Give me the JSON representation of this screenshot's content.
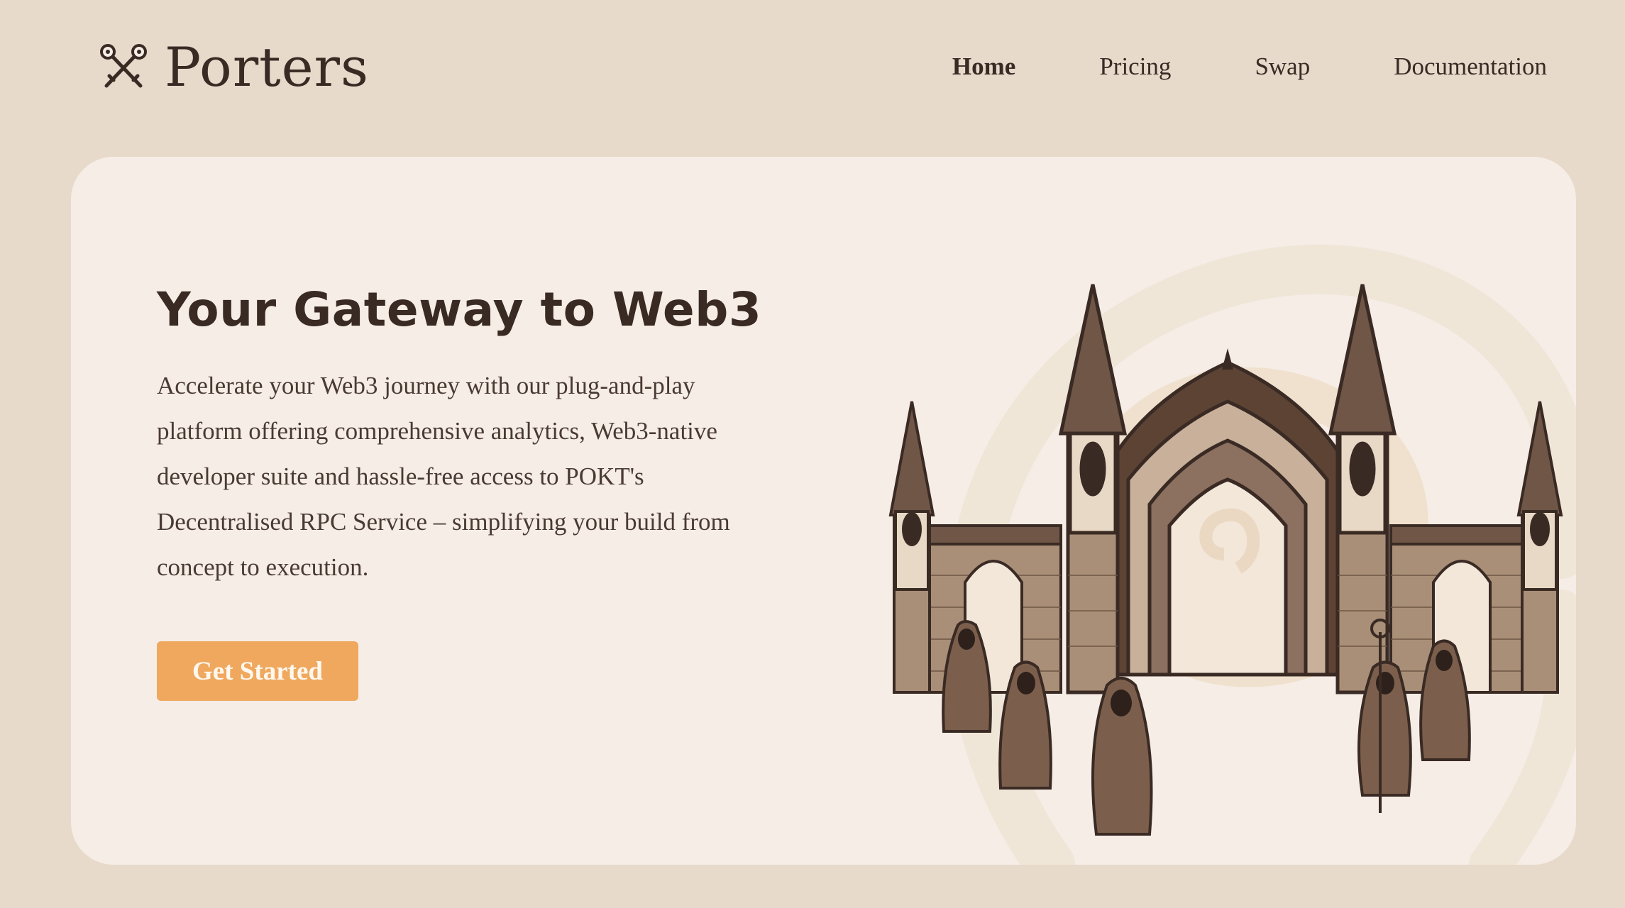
{
  "brand": {
    "name": "Porters",
    "logo_icon": "crossed-keys-icon"
  },
  "nav": {
    "items": [
      {
        "label": "Home",
        "active": true
      },
      {
        "label": "Pricing",
        "active": false
      },
      {
        "label": "Swap",
        "active": false
      },
      {
        "label": "Documentation",
        "active": false
      }
    ]
  },
  "hero": {
    "title": "Your Gateway to Web3",
    "description": "Accelerate your Web3 journey with our plug-and-play platform offering comprehensive analytics, Web3-native developer suite and hassle-free access to POKT's Decentralised RPC Service – simplifying your build from concept to execution.",
    "cta_label": "Get Started",
    "illustration": "gothic-gate-with-hooded-figures"
  },
  "colors": {
    "page_bg": "#e7dacb",
    "card_bg": "#f5ede6",
    "text": "#3a2a24",
    "accent": "#efa85e"
  }
}
